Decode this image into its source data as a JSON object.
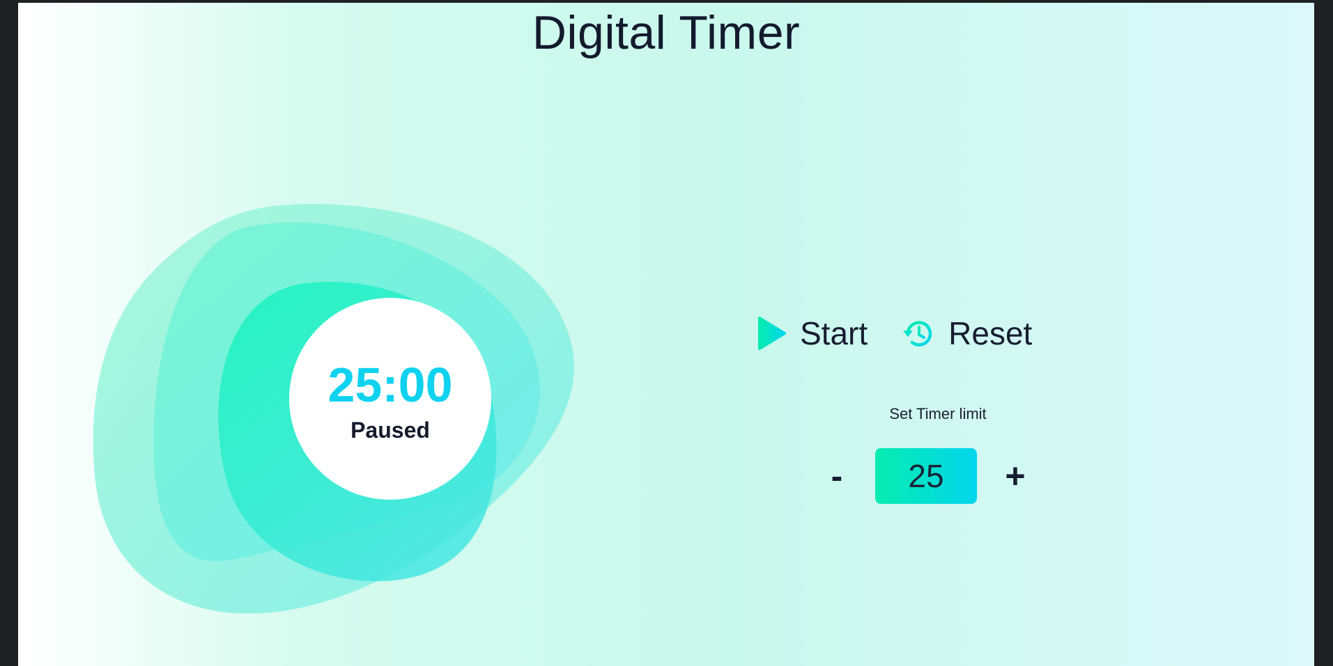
{
  "app": {
    "title": "Digital Timer"
  },
  "timer": {
    "display": "25:00",
    "status": "Paused"
  },
  "controls": {
    "start_label": "Start",
    "start_icon": "play-icon",
    "reset_label": "Reset",
    "reset_icon": "reset-history-icon"
  },
  "limit": {
    "label": "Set Timer limit",
    "decrement_label": "-",
    "value": "25",
    "increment_label": "+"
  },
  "colors": {
    "accent_green": "#06ecb0",
    "accent_cyan": "#02d6ee",
    "text_dark": "#171d30",
    "time_text": "#0fd2ef"
  }
}
